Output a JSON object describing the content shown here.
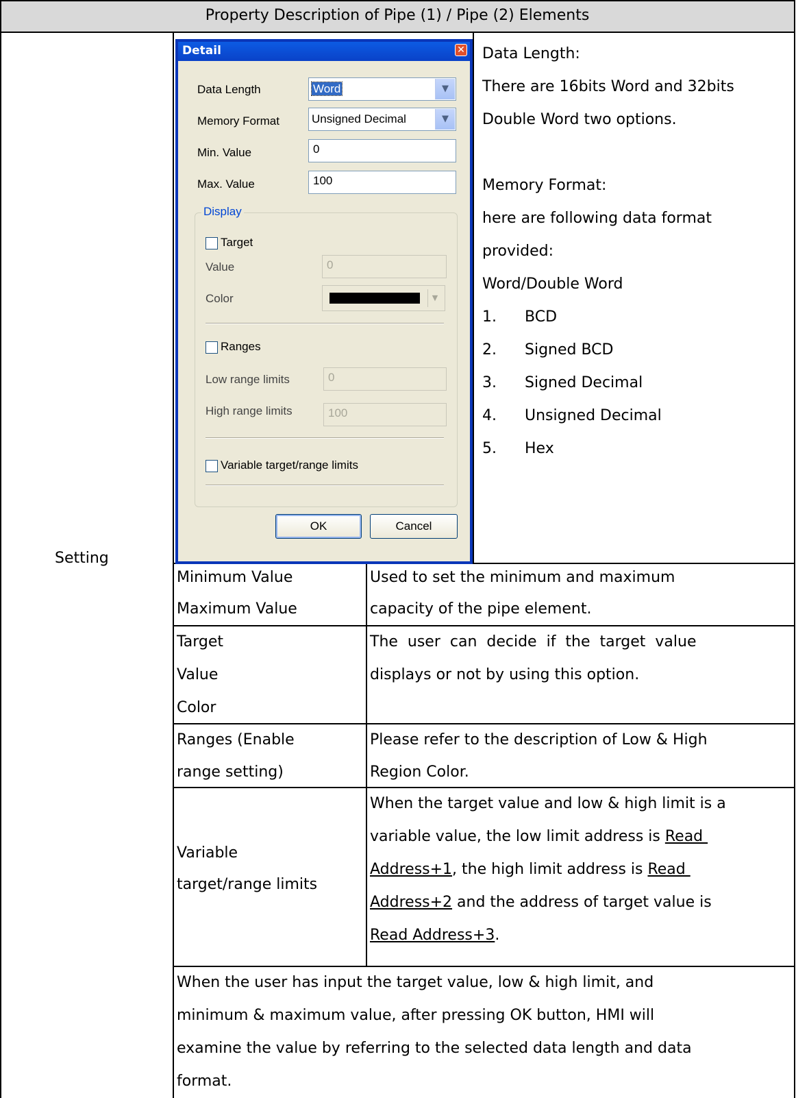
{
  "header": {
    "title": "Property Description of Pipe (1) / Pipe (2) Elements"
  },
  "left_label": "Setting",
  "dialog": {
    "title": "Detail",
    "close_glyph": "✕",
    "data_length_label": "Data Length",
    "data_length_value": "Word",
    "memory_format_label": "Memory Format",
    "memory_format_value": "Unsigned Decimal",
    "min_label": "Min. Value",
    "min_value": "0",
    "max_label": "Max. Value",
    "max_value": "100",
    "display_group": "Display",
    "target_label": "Target",
    "value_label": "Value",
    "value_value": "0",
    "color_label": "Color",
    "ranges_label": "Ranges",
    "low_label": "Low range limits",
    "low_value": "0",
    "high_label": "High range limits",
    "high_value": "100",
    "variable_label": "Variable target/range limits",
    "ok_label": "OK",
    "cancel_label": "Cancel"
  },
  "right_desc": {
    "l1": "Data Length:",
    "l2": "There are 16bits Word and 32bits",
    "l3": "Double Word two options.",
    "l4": "Memory Format:",
    "l5": "here are following data format",
    "l6": "provided:",
    "l7": "Word/Double Word",
    "items": [
      {
        "num": "1.",
        "text": "BCD"
      },
      {
        "num": "2.",
        "text": "Signed BCD"
      },
      {
        "num": "3.",
        "text": "Signed Decimal"
      },
      {
        "num": "4.",
        "text": "Unsigned Decimal"
      },
      {
        "num": "5.",
        "text": "Hex"
      }
    ]
  },
  "rows": {
    "r1": {
      "a1": "Minimum Value",
      "a2": "Maximum Value",
      "b1": "Used to set the minimum and maximum",
      "b2": "capacity of the pipe element."
    },
    "r2": {
      "a1": "Target",
      "a2": "Value",
      "a3": "Color",
      "b1": "The  user  can  decide  if  the  target  value",
      "b2": "displays or not by using this option."
    },
    "r3": {
      "a1": "Ranges (Enable",
      "a2": "range setting)",
      "b1": "Please refer to the description of Low & High",
      "b2": "Region Color."
    },
    "r4": {
      "a1": "Variable",
      "a2": "target/range limits",
      "b1": "When the target value and low & high limit is a",
      "b2a": "variable value, the low limit address is ",
      "b2u": "Read ",
      "b3u": "Address+1",
      "b3a": ", the high limit address is ",
      "b3u2": "Read ",
      "b4u": "Address+2",
      "b4a": " and the address of target value is",
      "b5u": "Read Address+3",
      "b5a": "."
    }
  },
  "note": {
    "l1": "When the user has input the target value, low & high limit, and",
    "l2": "minimum & maximum value, after pressing OK button, HMI will",
    "l3": "examine the value by referring to the selected data length and data",
    "l4": "format."
  }
}
